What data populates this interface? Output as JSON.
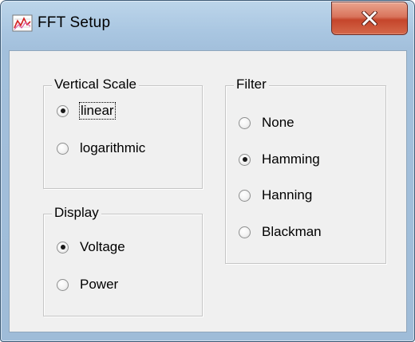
{
  "window": {
    "title": "FFT Setup",
    "close_icon": "close-x-icon",
    "app_icon": "chart-icon"
  },
  "vertical_scale": {
    "legend": "Vertical Scale",
    "options": [
      {
        "label": "linear",
        "checked": true,
        "focused": true
      },
      {
        "label": "logarithmic",
        "checked": false,
        "focused": false
      }
    ]
  },
  "display": {
    "legend": "Display",
    "options": [
      {
        "label": "Voltage",
        "checked": true
      },
      {
        "label": "Power",
        "checked": false
      }
    ]
  },
  "filter": {
    "legend": "Filter",
    "options": [
      {
        "label": "None",
        "checked": false
      },
      {
        "label": "Hamming",
        "checked": true
      },
      {
        "label": "Hanning",
        "checked": false
      },
      {
        "label": "Blackman",
        "checked": false
      }
    ]
  }
}
